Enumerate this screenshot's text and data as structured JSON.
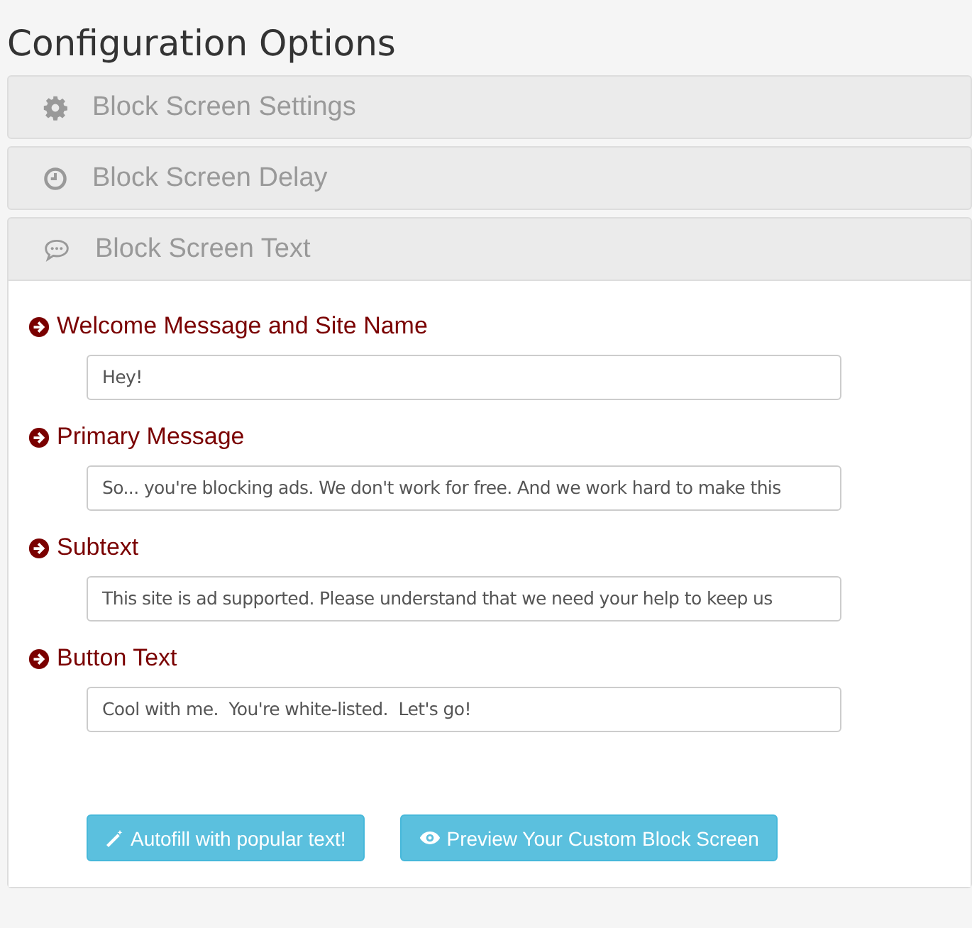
{
  "title": "Configuration Options",
  "panels": [
    {
      "label": "Block Screen Settings",
      "expanded": false
    },
    {
      "label": "Block Screen Delay",
      "expanded": false
    },
    {
      "label": "Block Screen Text",
      "expanded": true,
      "fields": [
        {
          "label": "Welcome Message and Site Name",
          "value": "Hey!"
        },
        {
          "label": "Primary Message",
          "value": "So... you're blocking ads. We don't work for free. And we work hard to make this"
        },
        {
          "label": "Subtext",
          "value": "This site is ad supported. Please understand that we need your help to keep us"
        },
        {
          "label": "Button Text",
          "value": "Cool with me.  You're white-listed.  Let's go!"
        }
      ],
      "buttons": [
        {
          "label": "Autofill with popular text!"
        },
        {
          "label": "Preview Your Custom Block Screen"
        }
      ]
    }
  ]
}
